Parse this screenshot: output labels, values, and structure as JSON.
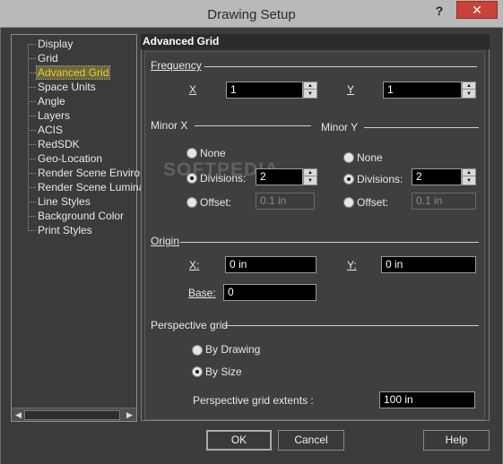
{
  "window": {
    "title": "Drawing Setup",
    "help_glyph": "?",
    "close_glyph": "✕"
  },
  "tree": {
    "items": [
      "Display",
      "Grid",
      "Advanced Grid",
      "Space Units",
      "Angle",
      "Layers",
      "ACIS",
      "RedSDK",
      "Geo-Location",
      "Render Scene Environment",
      "Render Scene Luminance",
      "Line Styles",
      "Background Color",
      "Print Styles"
    ],
    "visible_labels": [
      "Display",
      "Grid",
      "Advanced Grid",
      "Space Units",
      "Angle",
      "Layers",
      "ACIS",
      "RedSDK",
      "Geo-Location",
      "Render Scene Environ",
      "Render Scene Luminar",
      "Line Styles",
      "Background Color",
      "Print Styles"
    ],
    "selected": "Advanced Grid"
  },
  "panel": {
    "title": "Advanced Grid",
    "frequency": {
      "label": "Frequency",
      "x_label": "X",
      "x_value": "1",
      "y_label": "Y",
      "y_value": "1"
    },
    "minor_x": {
      "label": "Minor X",
      "none": "None",
      "divisions": "Divisions:",
      "divisions_value": "2",
      "offset": "Offset:",
      "offset_value": "0.1 in",
      "selected": "Divisions"
    },
    "minor_y": {
      "label": "Minor Y",
      "none": "None",
      "divisions": "Divisions:",
      "divisions_value": "2",
      "offset": "Offset:",
      "offset_value": "0.1 in",
      "selected": "Divisions"
    },
    "origin": {
      "label": "Origin",
      "x_label": "X:",
      "x_value": "0 in",
      "y_label": "Y:",
      "y_value": "0 in",
      "base_label": "Base:",
      "base_value": "0"
    },
    "perspective": {
      "label": "Perspective grid",
      "by_drawing": "By Drawing",
      "by_size": "By Size",
      "selected": "By Size",
      "extents_label": "Perspective grid extents :",
      "extents_value": "100 in"
    }
  },
  "buttons": {
    "ok": "OK",
    "cancel": "Cancel",
    "help": "Help"
  },
  "watermark": "SOFTPEDIA",
  "colors": {
    "selected_item_bg": "#6b6b2e",
    "close_button": "#c7423a",
    "field_bg": "#000000"
  }
}
